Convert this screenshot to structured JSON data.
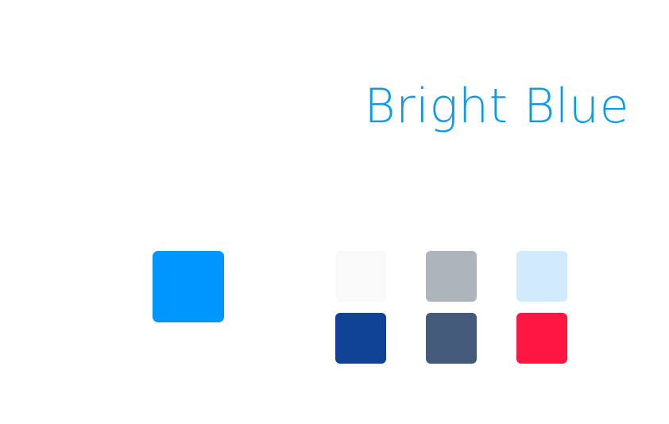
{
  "title": {
    "text": "Bright Blue",
    "color": "#0a9be8"
  },
  "primary_swatch": {
    "color": "#0096ff"
  },
  "secondary_swatches": [
    {
      "color": "#f9f9f9"
    },
    {
      "color": "#adb4bc"
    },
    {
      "color": "#d2eafd"
    },
    {
      "color": "#0f4195"
    },
    {
      "color": "#445a7a"
    },
    {
      "color": "#ff1744"
    }
  ]
}
